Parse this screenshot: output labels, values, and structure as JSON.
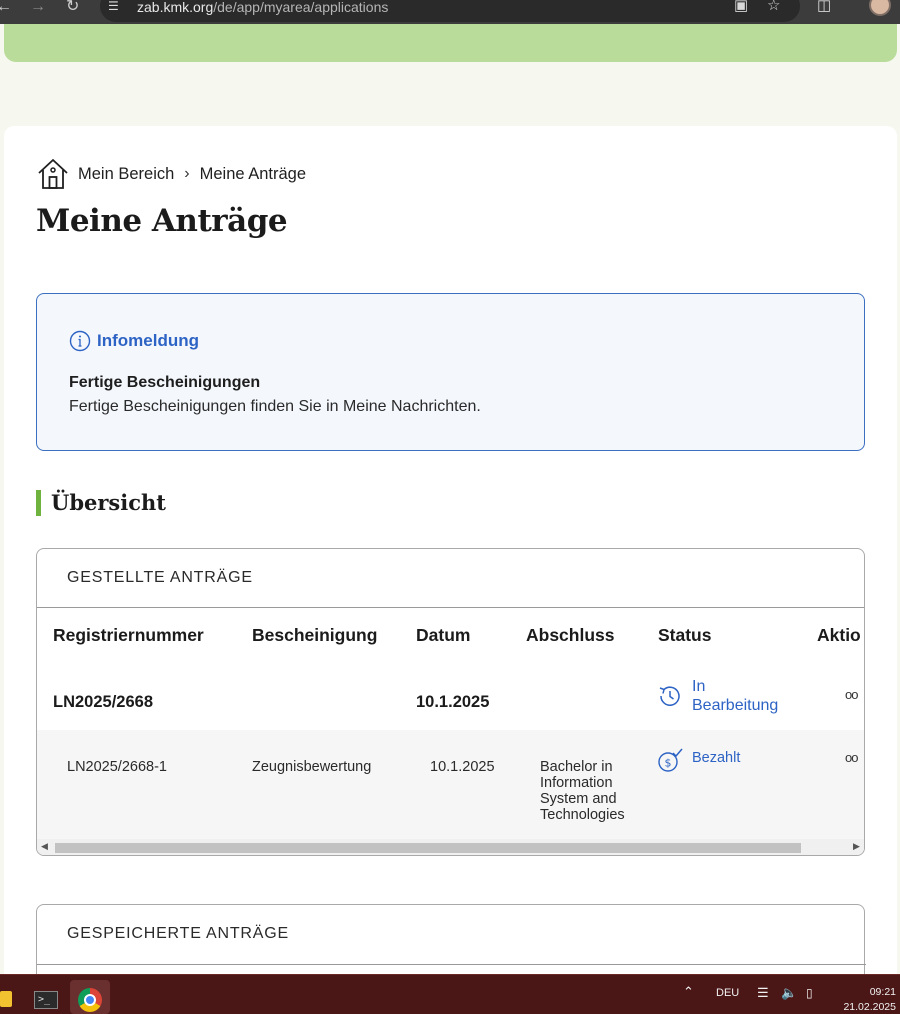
{
  "browser": {
    "url_host": "zab.kmk.org",
    "url_path": "/de/app/myarea/applications",
    "back_icon": "arrow-left-icon",
    "forward_icon": "arrow-right-icon",
    "reload_icon": "reload-icon"
  },
  "breadcrumb": {
    "home_icon": "home-icon",
    "items": [
      "Mein Bereich",
      "Meine Anträge"
    ],
    "separator": ">"
  },
  "page_title": "Meine Anträge",
  "info": {
    "heading": "Infomeldung",
    "title": "Fertige Bescheinigungen",
    "text": "Fertige Bescheinigungen finden Sie in Meine Nachrichten."
  },
  "section": {
    "title": "Übersicht",
    "accent": "#6fb33e"
  },
  "submitted": {
    "title": "GESTELLTE ANTRÄGE",
    "columns": [
      "Registriernummer",
      "Bescheinigung",
      "Datum",
      "Abschluss",
      "Status",
      "Aktio"
    ],
    "main_row": {
      "registration": "LN2025/2668",
      "date": "10.1.2025",
      "status_line1": "In",
      "status_line2": "Bearbeitung",
      "status_icon": "clock-history-icon"
    },
    "sub_row": {
      "registration": "LN2025/2668-1",
      "certificate": "Zeugnisbewertung",
      "date": "10.1.2025",
      "degree_lines": [
        "Bachelor in",
        "Information",
        "System and",
        "Technologies"
      ],
      "status": "Bezahlt",
      "status_icon": "paid-coin-icon"
    },
    "actions_symbol": "oo"
  },
  "saved": {
    "title": "GESPEICHERTE ANTRÄGE"
  },
  "taskbar": {
    "language": "DEU",
    "time": "09:21",
    "date": "21.02.2025",
    "terminal_glyph": ">_"
  },
  "colors": {
    "accent_blue": "#2d63c4",
    "banner_green": "#b9dc9b",
    "taskbar": "#4a1616"
  }
}
